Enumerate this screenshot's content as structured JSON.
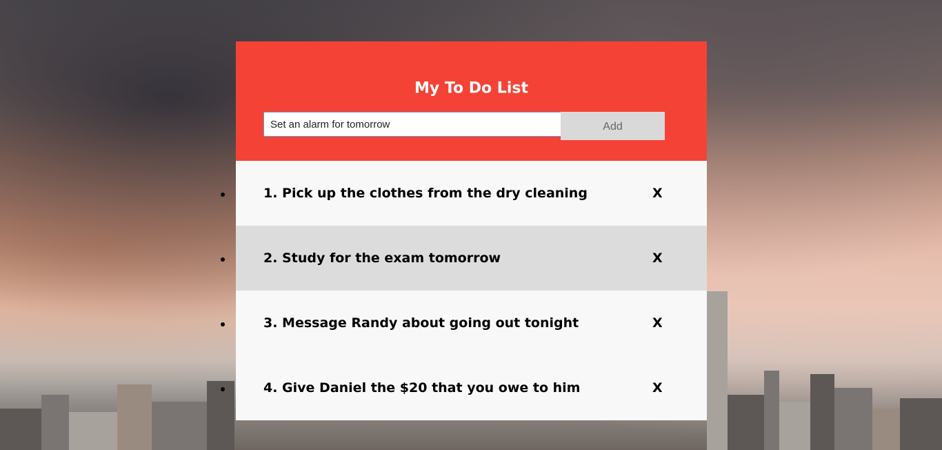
{
  "header": {
    "title": "My To Do List",
    "accent_color": "#f44336"
  },
  "entry": {
    "input_value": "Set an alarm for tomorrow",
    "add_label": "Add"
  },
  "todos": [
    {
      "text": "1. Pick up the clothes from the dry cleaning",
      "remove_label": "X"
    },
    {
      "text": "2. Study for the exam tomorrow",
      "remove_label": "X"
    },
    {
      "text": "3. Message Randy about going out tonight",
      "remove_label": "X"
    },
    {
      "text": "4. Give Daniel the $20 that you owe to him",
      "remove_label": "X"
    }
  ],
  "icons": {
    "bullet": "bullet-icon",
    "remove": "close-icon"
  }
}
